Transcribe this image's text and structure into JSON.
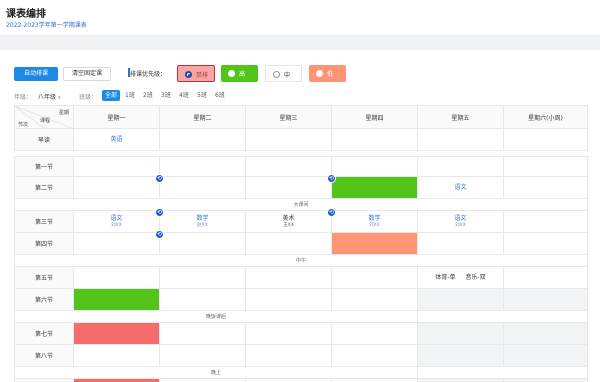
{
  "header": {
    "title": "课表编排",
    "subtitle": "2022-2023学年第一学期课表"
  },
  "toolbar": {
    "auto_label": "自动排课",
    "clear_label": "清空固定课",
    "priority_label": "排课优先级：",
    "priorities": [
      {
        "label": "禁排",
        "color": "#f7a6a6",
        "selected": true
      },
      {
        "label": "高",
        "color": "#52c41a"
      },
      {
        "label": "中",
        "color": "#ffffff"
      },
      {
        "label": "低",
        "color": "#ff9575"
      }
    ]
  },
  "filters": {
    "grade_label": "年级：",
    "grade_value": "八年级",
    "class_label": "班级：",
    "classes": [
      "全部",
      "1班",
      "2班",
      "3班",
      "4班",
      "5班",
      "6班"
    ],
    "selected_class": "全部"
  },
  "timetable": {
    "corner": {
      "top": "星期",
      "mid": "课程",
      "left": "节次"
    },
    "days": [
      "星期一",
      "星期二",
      "星期三",
      "星期四",
      "星期五",
      "星期六(小周)"
    ],
    "rows": {
      "early": "早读",
      "p1": "第一节",
      "p2": "第二节",
      "break": "大课间",
      "p3": "第三节",
      "p4": "第四节",
      "noon": "中午",
      "p5": "第五节",
      "p6": "第六节",
      "evening": "晚饭课后",
      "p7": "第七节",
      "p8": "第八节",
      "night": "晚上"
    },
    "cells": {
      "early_mon": "英语",
      "p2_fri": "语文",
      "p3_mon_course": "语文",
      "p3_mon_teacher": "刘XX",
      "p3_tue_course": "数学",
      "p3_tue_teacher": "赵XX",
      "p3_wed_course": "美术",
      "p3_wed_teacher": "王XX",
      "p3_thu_course": "数学",
      "p3_thu_teacher": "刘XX",
      "p3_fri_course": "语文",
      "p3_fri_teacher": "刘XX",
      "p5_fri_a": "体育-单",
      "p5_fri_b": "音乐-双"
    },
    "colors": {
      "green": "#52c41a",
      "red": "#f56c6c",
      "salmon": "#ff9575",
      "pin": "#1f5fc6"
    }
  }
}
